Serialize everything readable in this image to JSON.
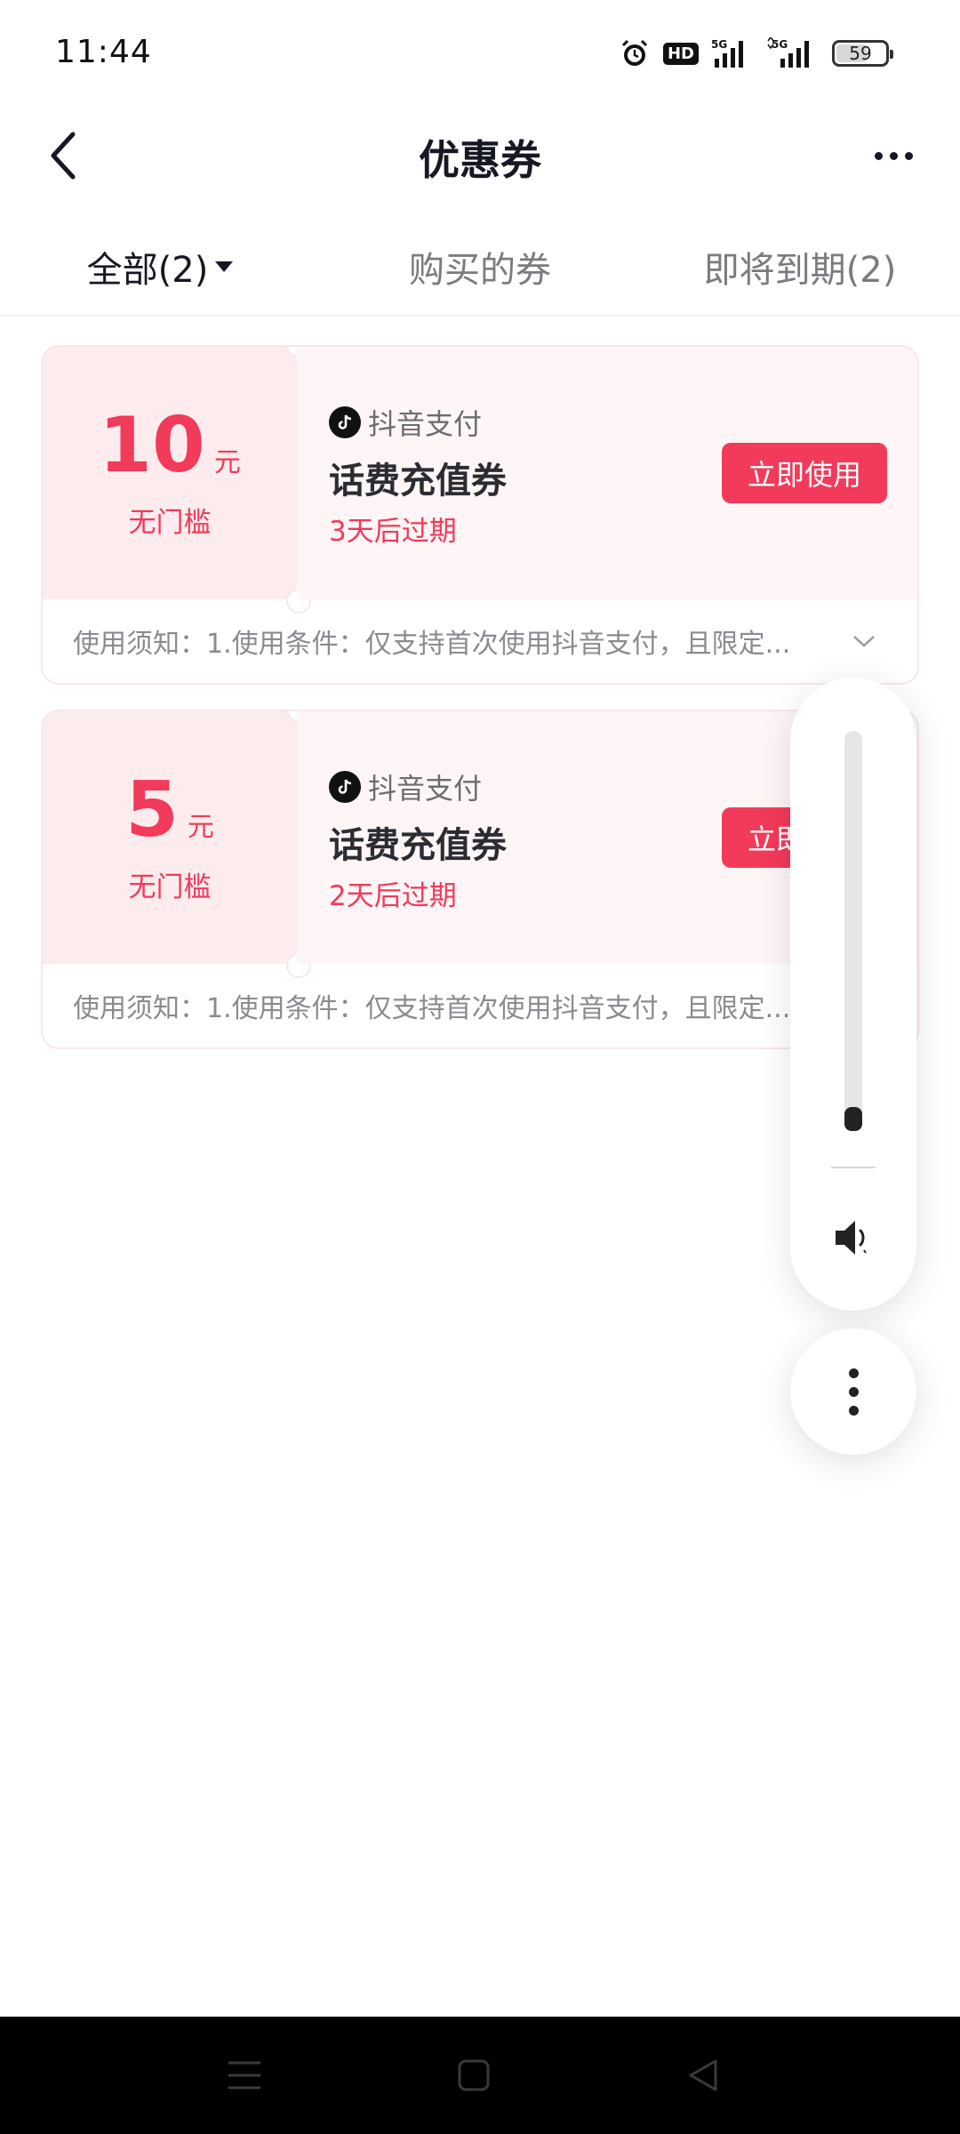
{
  "status_bar": {
    "time": "11:44",
    "hd_label": "HD",
    "network_1": "5G",
    "network_2": "5G",
    "battery": "59"
  },
  "header": {
    "title": "优惠券",
    "back_icon": "chevron-left-icon",
    "more_icon": "more-horizontal-icon"
  },
  "tabs": [
    {
      "label": "全部(2)",
      "active": true
    },
    {
      "label": "购买的券",
      "active": false
    },
    {
      "label": "即将到期(2)",
      "active": false
    }
  ],
  "coupons": [
    {
      "amount": "10",
      "unit": "元",
      "threshold": "无门槛",
      "brand": "抖音支付",
      "name": "话费充值券",
      "expiry": "3天后过期",
      "button": "立即使用",
      "notice": "使用须知：1.使用条件：仅支持首次使用抖音支付，且限定..."
    },
    {
      "amount": "5",
      "unit": "元",
      "threshold": "无门槛",
      "brand": "抖音支付",
      "name": "话费充值券",
      "expiry": "2天后过期",
      "button": "立即使用",
      "notice": "使用须知：1.使用条件：仅支持首次使用抖音支付，且限定..."
    }
  ],
  "volume": {
    "level_fraction": 0.06,
    "icon": "speaker-icon",
    "more_icon": "more-vertical-icon"
  },
  "colors": {
    "accent": "#f23a5a",
    "coupon_left_bg": "#fdecee",
    "coupon_right_bg": "#fef5f6"
  },
  "nav": {
    "menu_icon": "menu-icon",
    "home_icon": "home-square-icon",
    "back_icon": "back-triangle-icon"
  }
}
